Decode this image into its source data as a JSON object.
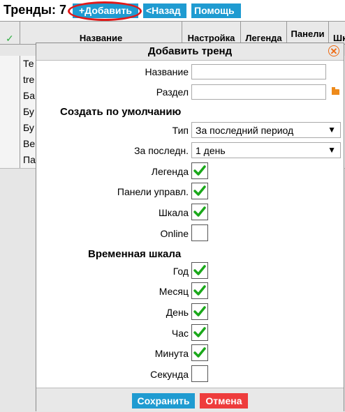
{
  "toolbar": {
    "title": "Тренды: 7",
    "add_label": "+Добавить",
    "back_label": "<Назад",
    "help_label": "Помощь"
  },
  "grid": {
    "columns": [
      "Название",
      "Настройка",
      "Легенда",
      "Панели",
      "Шк"
    ],
    "rows": [
      "Те",
      "tre",
      "Ба",
      "Бу",
      "Бу",
      "Be",
      "Па"
    ]
  },
  "dialog": {
    "title": "Добавить тренд",
    "name_label": "Название",
    "name_value": "",
    "section_label": "Раздел",
    "section_value": "",
    "defaults_header": "Создать по умолчанию",
    "type_label": "Тип",
    "type_value": "За последний период",
    "period_label": "За последн.",
    "period_value": "1 день",
    "options": [
      {
        "label": "Легенда",
        "checked": true
      },
      {
        "label": "Панели управл.",
        "checked": true
      },
      {
        "label": "Шкала",
        "checked": true
      },
      {
        "label": "Online",
        "checked": false
      }
    ],
    "timescale_header": "Временная шкала",
    "timescale": [
      {
        "label": "Год",
        "checked": true
      },
      {
        "label": "Месяц",
        "checked": true
      },
      {
        "label": "День",
        "checked": true
      },
      {
        "label": "Час",
        "checked": true
      },
      {
        "label": "Минута",
        "checked": true
      },
      {
        "label": "Секунда",
        "checked": false
      }
    ],
    "save_label": "Сохранить",
    "cancel_label": "Отмена"
  },
  "colors": {
    "button_blue": "#1f9bd1",
    "cancel_red": "#ee3c3c",
    "check_green": "#1aa81a",
    "highlight_red": "#e11919"
  }
}
